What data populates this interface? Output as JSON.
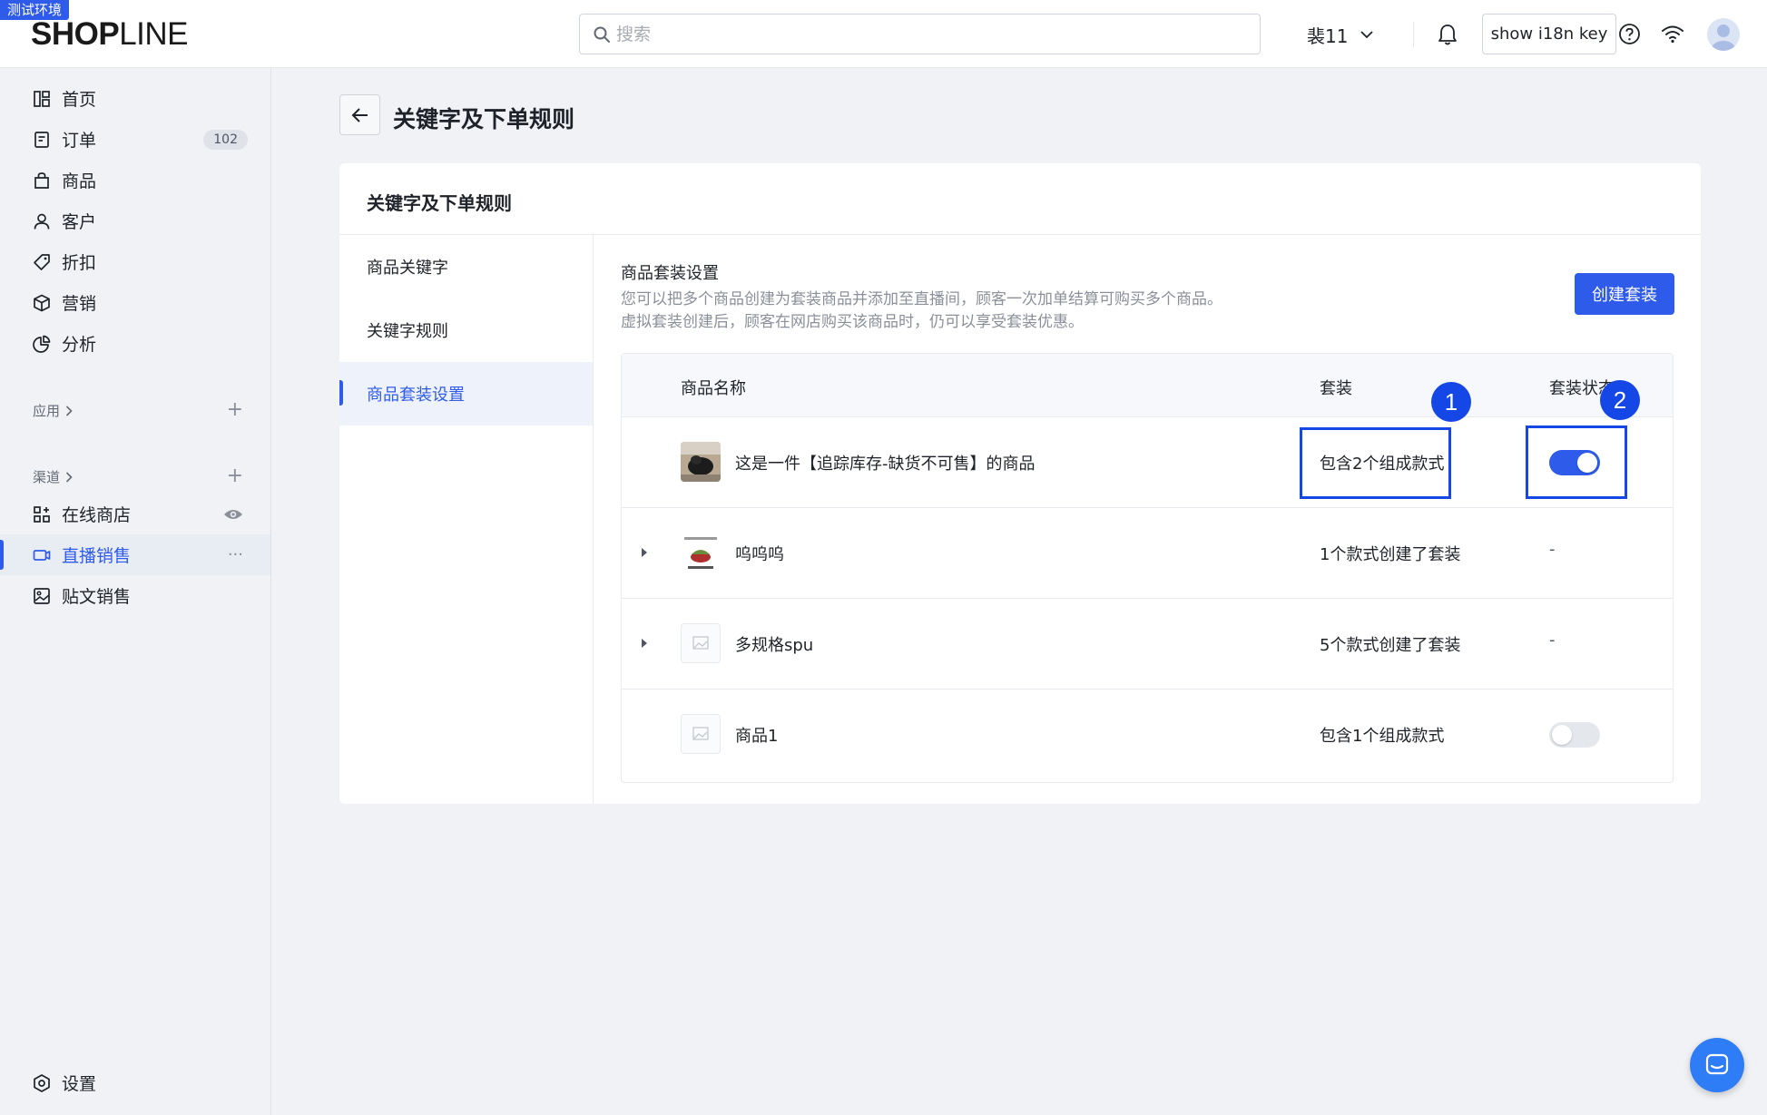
{
  "env_badge": "测试环境",
  "brand": {
    "logo_bold": "SHOP",
    "logo_light": "LINE"
  },
  "header": {
    "search_placeholder": "搜索",
    "store_name": "裴11",
    "i18n_button": "show i18n key"
  },
  "sidebar": {
    "items": [
      {
        "label": "首页",
        "icon": "layout-icon"
      },
      {
        "label": "订单",
        "icon": "order-icon",
        "badge": "102"
      },
      {
        "label": "商品",
        "icon": "bag-icon"
      },
      {
        "label": "客户",
        "icon": "user-icon"
      },
      {
        "label": "折扣",
        "icon": "tag-icon"
      },
      {
        "label": "营销",
        "icon": "cube-icon"
      },
      {
        "label": "分析",
        "icon": "pie-icon"
      }
    ],
    "apps_label": "应用",
    "channels_label": "渠道",
    "channels": [
      {
        "label": "在线商店",
        "icon": "store-icon"
      },
      {
        "label": "直播销售",
        "icon": "live-icon",
        "extra": "···"
      },
      {
        "label": "贴文销售",
        "icon": "post-icon"
      }
    ],
    "settings_label": "设置"
  },
  "page": {
    "title": "关键字及下单规则"
  },
  "card": {
    "title": "关键字及下单规则",
    "subnav": [
      "商品关键字",
      "关键字规则",
      "商品套装设置"
    ],
    "section_title": "商品套装设置",
    "section_desc_1": "您可以把多个商品创建为套装商品并添加至直播间，顾客一次加单结算可购买多个商品。",
    "section_desc_2": "虚拟套装创建后，顾客在网店购买该商品时，仍可以享受套装优惠。",
    "create_button": "创建套装",
    "table": {
      "headers": [
        "商品名称",
        "套装",
        "套装状态"
      ],
      "rows": [
        {
          "name": "这是一件【追踪库存-缺货不可售】的商品",
          "package": "包含2个组成款式",
          "status": "on",
          "expandable": false
        },
        {
          "name": "呜呜呜",
          "package": "1个款式创建了套装",
          "status": "-",
          "expandable": true
        },
        {
          "name": "多规格spu",
          "package": "5个款式创建了套装",
          "status": "-",
          "expandable": true
        },
        {
          "name": "商品1",
          "package": "包含1个组成款式",
          "status": "off",
          "expandable": false
        }
      ]
    }
  },
  "annotations": [
    "1",
    "2"
  ],
  "colors": {
    "primary": "#2f5bea",
    "annotation": "#1447e6"
  }
}
